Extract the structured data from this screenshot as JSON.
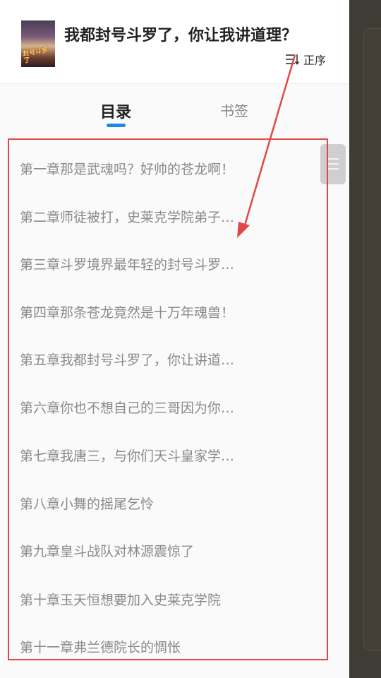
{
  "book": {
    "title": "我都封号斗罗了，你让我讲道理？",
    "cover_text": "封号斗罗了"
  },
  "sort": {
    "icon": "sort-order-icon",
    "label": "正序"
  },
  "tabs": [
    {
      "label": "目录",
      "active": true
    },
    {
      "label": "书签",
      "active": false
    }
  ],
  "chapters": [
    "第一章那是武魂吗？好帅的苍龙啊！",
    "第二章师徒被打，史莱克学院弟子…",
    "第三章斗罗境界最年轻的封号斗罗…",
    "第四章那条苍龙竟然是十万年魂兽！",
    "第五章我都封号斗罗了，你让讲道…",
    "第六章你也不想自己的三哥因为你…",
    "第七章我唐三，与你们天斗皇家学…",
    "第八章小舞的摇尾乞怜",
    "第九章皇斗战队对林源震惊了",
    "第十章玉天恒想要加入史莱克学院",
    "第十一章弗兰德院长的惆怅"
  ],
  "colors": {
    "accent": "#1e88e5",
    "annotation": "#e04848",
    "backdrop": "#403d36"
  }
}
